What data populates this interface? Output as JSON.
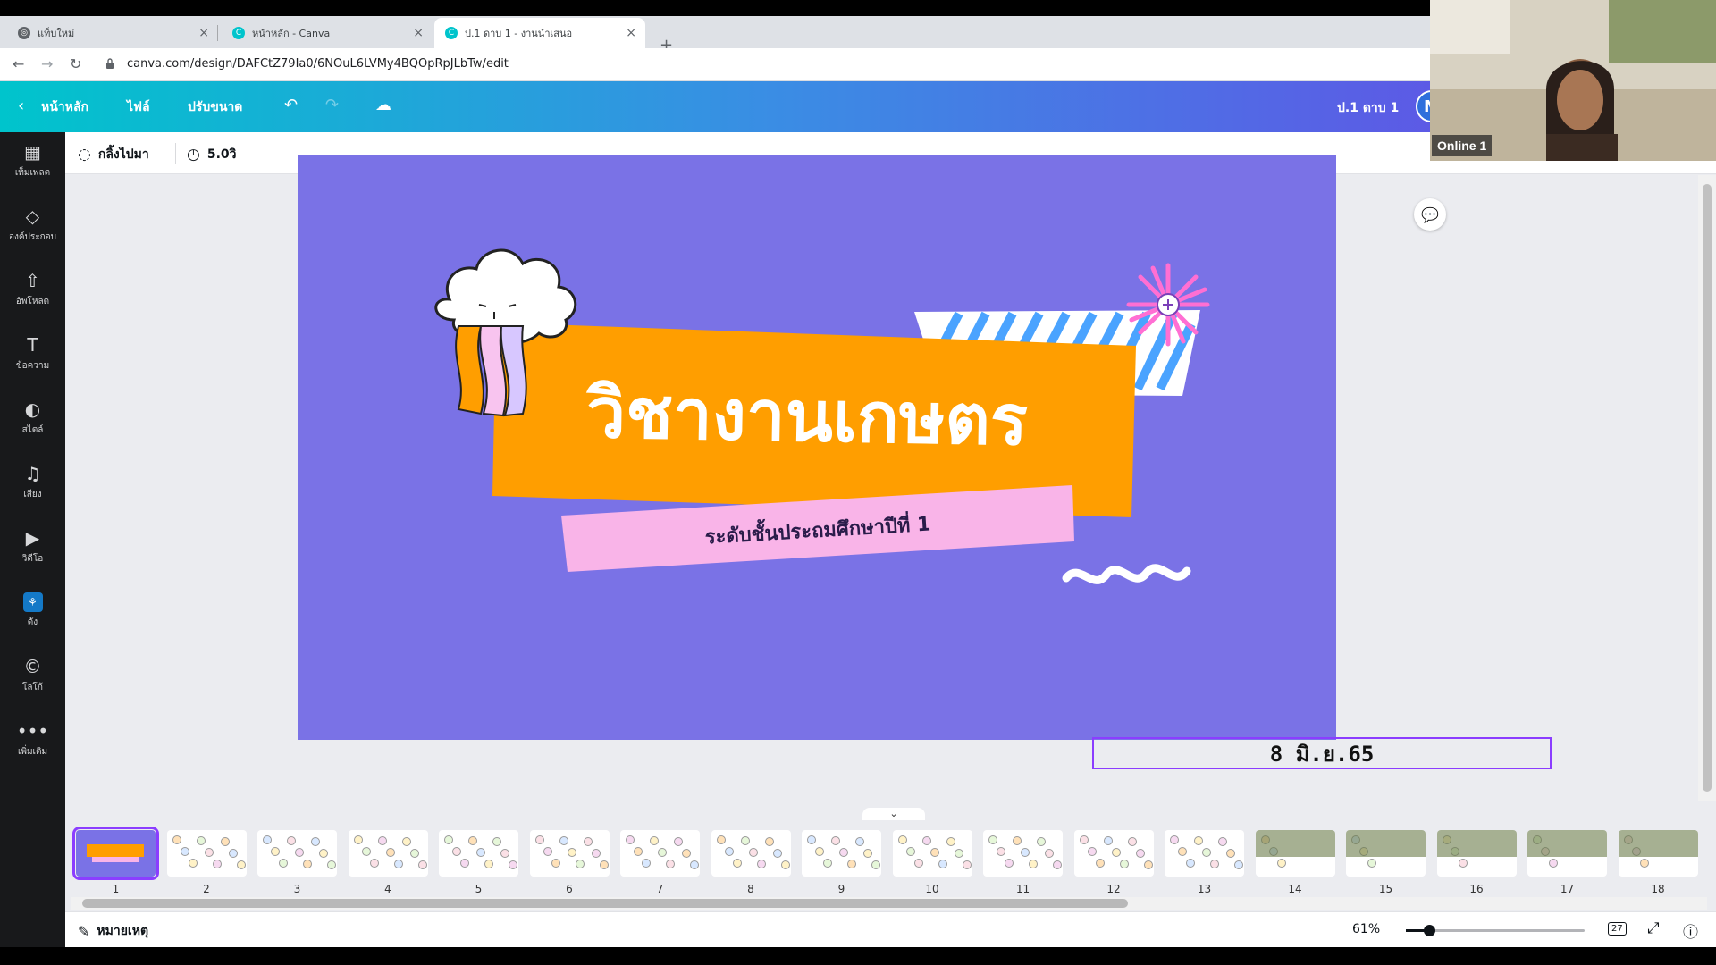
{
  "browser": {
    "tabs": [
      {
        "title": "แท็บใหม่",
        "active": false
      },
      {
        "title": "หน้าหลัก - Canva",
        "active": false
      },
      {
        "title": "ป.1 ดาบ 1 - งานนำเสนอ",
        "active": true
      }
    ],
    "new_tab_symbol": "+",
    "url": "canva.com/design/DAFCtZ79Ia0/6NOuL6LVMy4BQOpRpJLbTw/edit"
  },
  "header": {
    "home_label": "หน้าหลัก",
    "file_label": "ไฟล์",
    "resize_label": "ปรับขนาด",
    "doc_title": "ป.1 ดาบ 1",
    "avatar_initial": "M"
  },
  "toolbar": {
    "animate_label": "กลิ้งไปมา",
    "duration_label": "5.0วิ"
  },
  "sidebar": {
    "items": [
      {
        "label": "เท็มเพลต",
        "icon": "template-icon"
      },
      {
        "label": "องค์ประกอบ",
        "icon": "elements-icon"
      },
      {
        "label": "อัพโหลด",
        "icon": "upload-icon"
      },
      {
        "label": "ข้อความ",
        "icon": "text-icon"
      },
      {
        "label": "สไตล์",
        "icon": "palette-icon"
      },
      {
        "label": "เสียง",
        "icon": "music-icon"
      },
      {
        "label": "วิดีโอ",
        "icon": "video-icon"
      },
      {
        "label": "ดัง",
        "icon": "apps-icon"
      },
      {
        "label": "โลโก้",
        "icon": "logo-icon"
      },
      {
        "label": "เพิ่มเติม",
        "icon": "more-icon"
      }
    ]
  },
  "slide": {
    "title": "วิชางานเกษตร",
    "subtitle": "ระดับชั้นประถมศึกษาปีที่ 1",
    "date": "8 มิ.ย.65",
    "colors": {
      "background": "#7a72e6",
      "banner": "#ff9e00",
      "pink": "#f9b4e8"
    }
  },
  "filmstrip": {
    "pages": [
      "1",
      "2",
      "3",
      "4",
      "5",
      "6",
      "7",
      "8",
      "9",
      "10",
      "11",
      "12",
      "13",
      "14",
      "15",
      "16",
      "17",
      "18"
    ],
    "selected": "1"
  },
  "bottombar": {
    "notes_label": "หมายเหตุ",
    "zoom": "61%",
    "page_count": "27"
  },
  "webcam": {
    "label": "Online 1"
  }
}
